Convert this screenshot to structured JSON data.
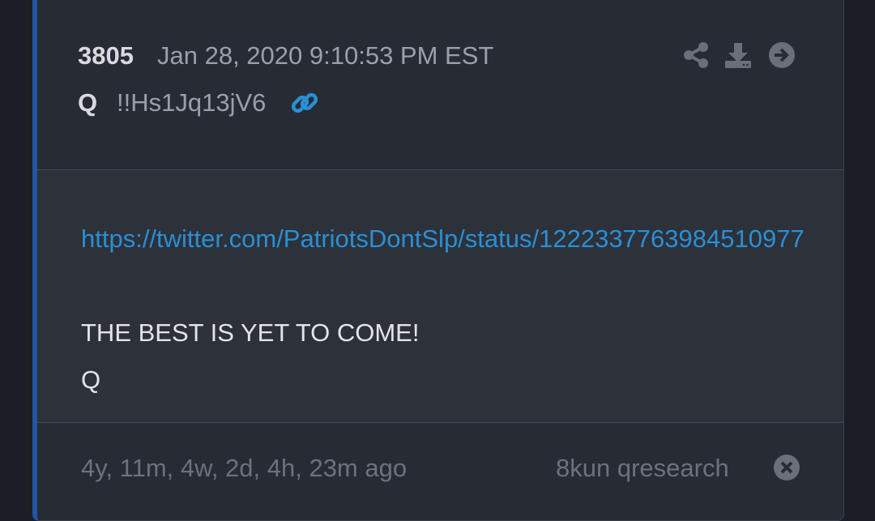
{
  "post": {
    "number": "3805",
    "date": "Jan 28, 2020 9:10:53 PM EST",
    "author": "Q",
    "tripcode": "!!Hs1Jq13jV6",
    "link": "https://twitter.com/PatriotsDontSlp/status/1222337763984510977",
    "text": "THE BEST IS YET TO COME!",
    "signature": "Q"
  },
  "footer": {
    "age": "4y, 11m, 4w, 2d, 4h, 23m ago",
    "source": "8kun qresearch"
  },
  "icons": {
    "permalink": "link-icon",
    "share": "share-icon",
    "download": "download-icon",
    "navigate": "arrow-right-circle-icon",
    "dismiss": "close-circle-icon"
  },
  "colors": {
    "accent_border": "#1f57a4",
    "link": "#2a8fd4",
    "card_bg": "#272b33",
    "body_bg": "#2c313a"
  }
}
